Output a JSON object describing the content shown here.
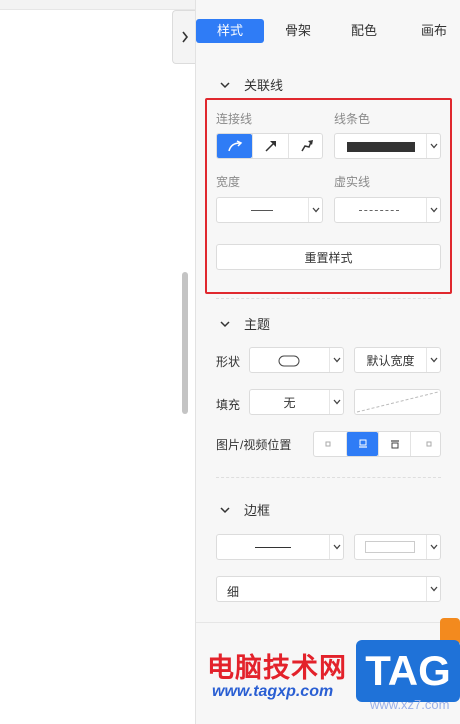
{
  "panel": {
    "tabs": [
      {
        "label": "样式",
        "active": true
      },
      {
        "label": "骨架",
        "active": false
      },
      {
        "label": "配色",
        "active": false
      },
      {
        "label": "画布",
        "active": false
      }
    ]
  },
  "relation_line": {
    "title": "关联线",
    "connector_label": "连接线",
    "line_color_label": "线条色",
    "line_color_value": "#333333",
    "width_label": "宽度",
    "dash_label": "虚实线",
    "reset_label": "重置样式"
  },
  "theme": {
    "title": "主题",
    "shape_label": "形状",
    "default_width_value": "默认宽度",
    "fill_label": "填充",
    "fill_value": "无",
    "image_position_label": "图片/视频位置"
  },
  "border": {
    "title": "边框",
    "thickness_value": "细"
  },
  "watermark": {
    "site_name": "电脑技术网",
    "site_url": "www.tagxp.com",
    "site_url2": "www.xz7.com",
    "tag_label": "TAG"
  },
  "colors": {
    "accent": "#2f7cf6",
    "highlight_frame": "#e0282e"
  }
}
